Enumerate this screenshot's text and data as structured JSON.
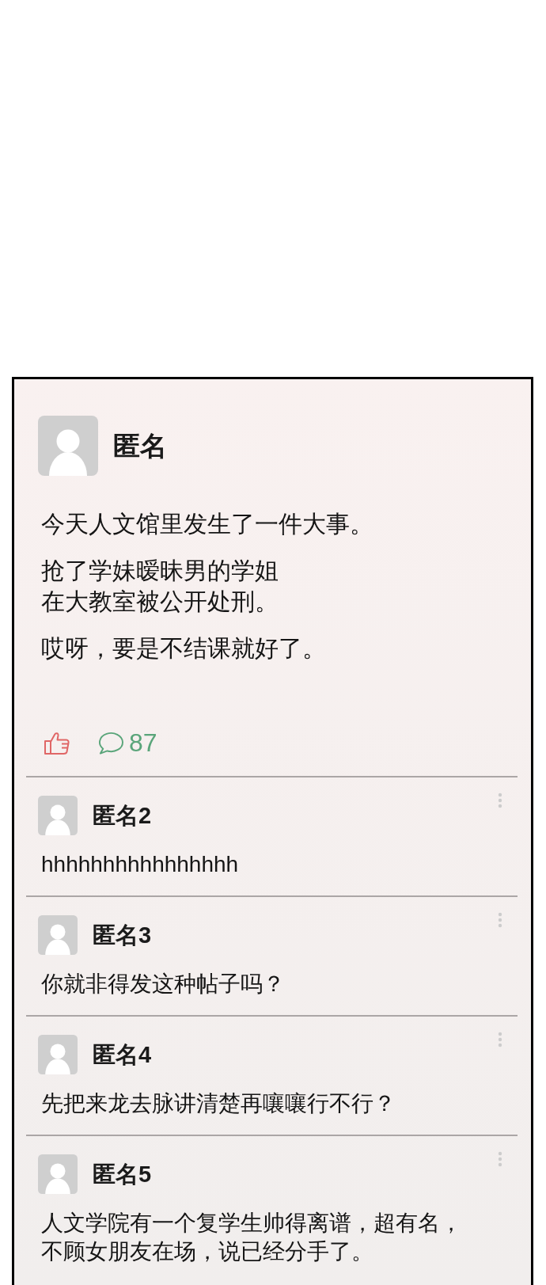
{
  "post": {
    "author": "匿名",
    "paragraphs": [
      [
        "今天人文馆里发生了一件大事。"
      ],
      [
        "抢了学妹暧昧男的学姐",
        "在大教室被公开处刑。"
      ],
      [
        "哎呀，要是不结课就好了。"
      ]
    ],
    "comment_count": "87"
  },
  "comments": [
    {
      "author": "匿名2",
      "lines": [
        "hhhhhhhhhhhhhhhh"
      ]
    },
    {
      "author": "匿名3",
      "lines": [
        "你就非得发这种帖子吗？"
      ]
    },
    {
      "author": "匿名4",
      "lines": [
        "先把来龙去脉讲清楚再嚷嚷行不行？"
      ]
    },
    {
      "author": "匿名5",
      "lines": [
        "人文学院有一个复学生帅得离谱，超有名，",
        "不顾女朋友在场，说已经分手了。"
      ]
    }
  ]
}
